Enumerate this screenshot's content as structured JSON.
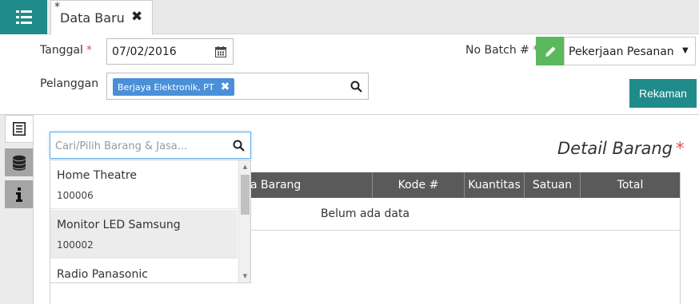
{
  "tab": {
    "modified_marker": "*",
    "title": "Data Baru"
  },
  "form": {
    "tanggal_label": "Tanggal",
    "required_mark": "*",
    "tanggal_value": "07/02/2016",
    "pelanggan_label": "Pelanggan",
    "pelanggan_chip": "Berjaya Elektronik, PT",
    "batch_label": "No Batch #",
    "batch_value": "Pekerjaan Pesanan",
    "save_label": "Rekaman"
  },
  "detail": {
    "title": "Detail Barang",
    "table_headers": [
      "a Barang",
      "Kode #",
      "Kuantitas",
      "Satuan",
      "Total"
    ],
    "empty_text": "Belum ada data"
  },
  "dropdown": {
    "placeholder": "Cari/Pilih Barang & Jasa...",
    "items": [
      {
        "name": "Home Theatre",
        "code": "100006",
        "highlighted": false
      },
      {
        "name": "Monitor LED Samsung",
        "code": "100002",
        "highlighted": true
      },
      {
        "name": "Radio Panasonic",
        "code": "",
        "highlighted": false
      }
    ]
  },
  "icons": {
    "menu": "list-icon",
    "calendar": "calendar-icon",
    "search": "search-icon",
    "edit": "pencil-icon",
    "side_tabs": [
      "document-list-icon",
      "database-icon",
      "info-icon"
    ]
  },
  "colors": {
    "teal": "#1f8b8b",
    "green": "#5cb85c",
    "chip_blue": "#4a90d9",
    "required_red": "#d9534f",
    "table_header": "#5a5a5a"
  }
}
